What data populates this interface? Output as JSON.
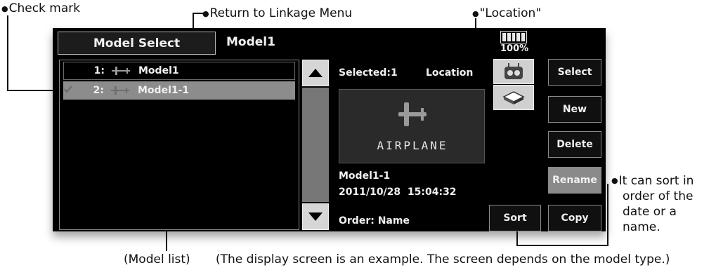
{
  "annotations": {
    "check_mark": "Check mark",
    "return_to_linkage": "Return to Linkage Menu",
    "location": "\"Location\"",
    "sort_note_1": "It can sort in",
    "sort_note_2": "order of the",
    "sort_note_3": "date or a",
    "sort_note_4": "name.",
    "model_list": "(Model list)",
    "disclaimer": "(The display screen is an example. The screen depends on the model type.)"
  },
  "header": {
    "title": "Model Select",
    "current_model": "Model1",
    "battery_percent": "100%"
  },
  "model_list": {
    "items": [
      {
        "number": "1:",
        "name": "Model1"
      },
      {
        "number": "2:",
        "name": "Model1-1"
      }
    ]
  },
  "info": {
    "selected": "Selected:1",
    "location_label": "Location",
    "preview_type": "AIRPLANE",
    "model_name": "Model1-1",
    "timestamp": "2011/10/28  15:04:32",
    "order": "Order: Name"
  },
  "buttons": {
    "select": "Select",
    "new": "New",
    "delete": "Delete",
    "rename": "Rename",
    "copy": "Copy",
    "sort": "Sort"
  }
}
